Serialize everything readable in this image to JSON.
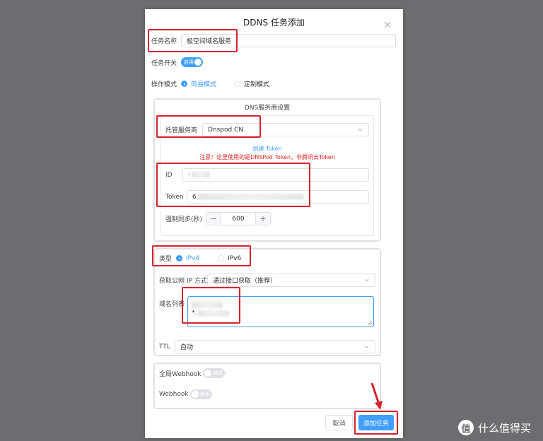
{
  "dialog": {
    "title": "DDNS 任务添加"
  },
  "form": {
    "task_name_label": "任务名称",
    "task_name_value": "极空间域名服务",
    "task_switch_label": "任务开关",
    "task_switch_text": "启用",
    "mode_label": "操作模式",
    "mode_options": [
      "简易模式",
      "定制模式"
    ],
    "mode_selected": "简易模式"
  },
  "dns_provider": {
    "section_title": "DNS服务商设置",
    "provider_label": "托管服务商",
    "provider_value": "Dnspod.CN",
    "create_token_link": "创建 Token",
    "warning_text": "注意！这里使用的是DNSPod Token，非腾讯云Token",
    "id_label": "ID",
    "id_value": "I",
    "token_label": "Token",
    "token_value": "6",
    "sync_label": "强制同步(秒)",
    "sync_minus": "−",
    "sync_value": "600",
    "sync_plus": "+"
  },
  "record": {
    "type_label": "类型",
    "type_options": [
      "IPv4",
      "IPv6"
    ],
    "type_selected": "IPv4",
    "ip_method_label": "获取公网 IP 方式",
    "ip_method_value": "通过接口获取（推荐）",
    "domain_list_label": "域名列表",
    "domain_line2_prefix": "*.",
    "ttl_label": "TTL",
    "ttl_value": "自动"
  },
  "webhook": {
    "global_label": "全局Webhook",
    "global_switch_text": "禁用",
    "webhook_label": "Webhook",
    "webhook_switch_text": "禁用"
  },
  "footer": {
    "cancel_label": "取消",
    "submit_label": "添加任务"
  },
  "watermark": {
    "logo_char": "值",
    "text": "什么值得买"
  },
  "colors": {
    "primary": "#409eff",
    "highlight": "#d6232c",
    "warning": "#e02020"
  }
}
